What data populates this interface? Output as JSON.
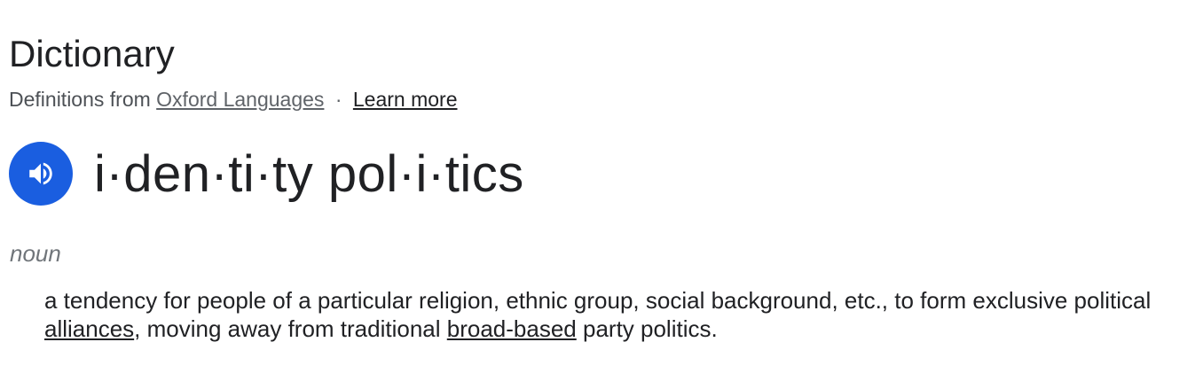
{
  "header": {
    "title": "Dictionary",
    "source_prefix": "Definitions from",
    "source_name": "Oxford Languages",
    "separator": "·",
    "learn_more": "Learn more"
  },
  "entry": {
    "headword": "i·den·ti·ty pol·i·tics",
    "pronounce_icon": "speaker-icon",
    "part_of_speech": "noun",
    "definition": {
      "part1": "a tendency for people of a particular religion, ethnic group, social background, etc., to form exclusive political ",
      "link1": "alliances",
      "part2": ", moving away from traditional ",
      "link2": "broad-based",
      "part3": " party politics."
    }
  },
  "colors": {
    "accent": "#1a5ee0",
    "text": "#202124",
    "muted": "#70757a"
  }
}
